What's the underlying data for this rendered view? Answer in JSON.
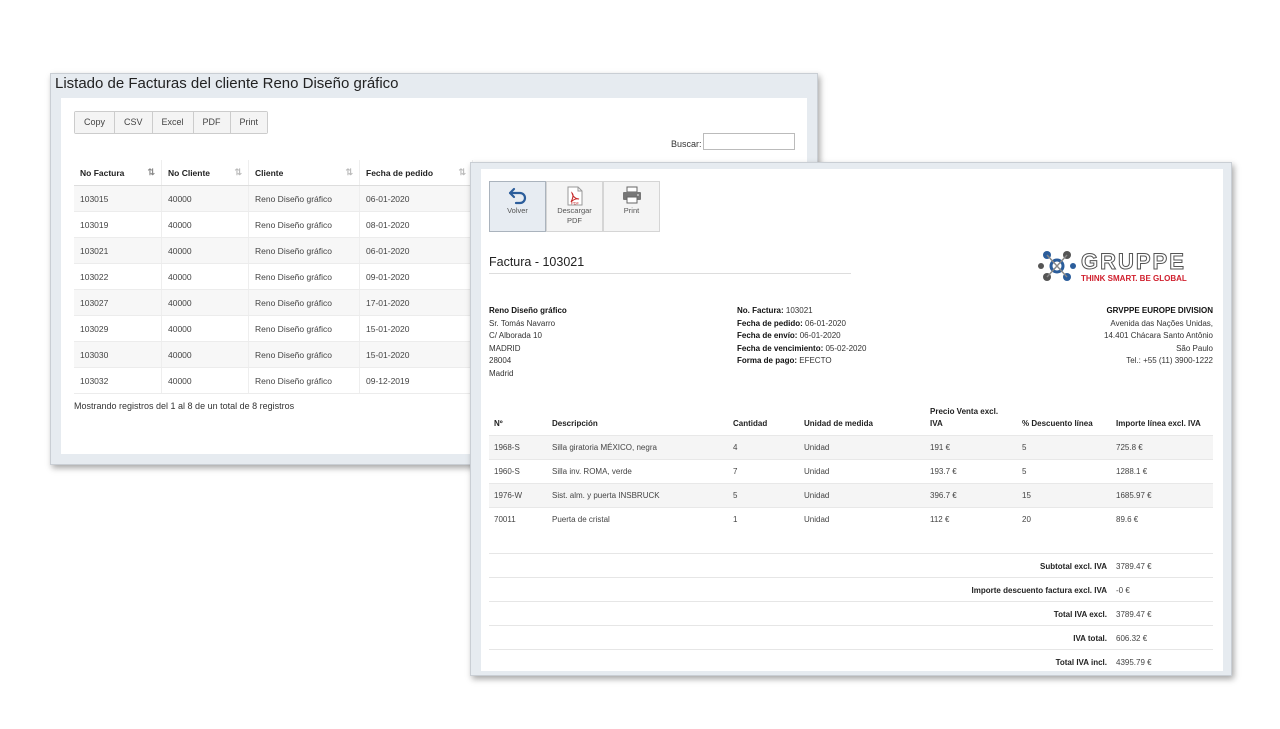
{
  "list": {
    "title": "Listado de Facturas del cliente Reno Diseño gráfico",
    "buttons": [
      "Copy",
      "CSV",
      "Excel",
      "PDF",
      "Print"
    ],
    "search_label": "Buscar:",
    "columns": [
      "No Factura",
      "No Cliente",
      "Cliente",
      "Fecha de pedido"
    ],
    "rows": [
      [
        "103015",
        "40000",
        "Reno Diseño gráfico",
        "06-01-2020"
      ],
      [
        "103019",
        "40000",
        "Reno Diseño gráfico",
        "08-01-2020"
      ],
      [
        "103021",
        "40000",
        "Reno Diseño gráfico",
        "06-01-2020"
      ],
      [
        "103022",
        "40000",
        "Reno Diseño gráfico",
        "09-01-2020"
      ],
      [
        "103027",
        "40000",
        "Reno Diseño gráfico",
        "17-01-2020"
      ],
      [
        "103029",
        "40000",
        "Reno Diseño gráfico",
        "15-01-2020"
      ],
      [
        "103030",
        "40000",
        "Reno Diseño gráfico",
        "15-01-2020"
      ],
      [
        "103032",
        "40000",
        "Reno Diseño gráfico",
        "09-12-2019"
      ]
    ],
    "info": "Mostrando registros del 1 al 8 de un total de 8 registros"
  },
  "invoice": {
    "toolbar": {
      "back": "Volver",
      "download_l1": "Descargar",
      "download_l2": "PDF",
      "print": "Print",
      "pdf_icon_text": "PDF"
    },
    "title": "Factura - 103021",
    "logo": {
      "brand": "GRUPPE",
      "tagline": "THINK SMART. BE GLOBAL"
    },
    "client": [
      "Reno Diseño gráfico",
      "Sr. Tomás Navarro",
      "C/ Alborada 10",
      "MADRID",
      "28004",
      "Madrid"
    ],
    "meta": [
      {
        "label": "No. Factura:",
        "value": "103021"
      },
      {
        "label": "Fecha de pedido:",
        "value": "06-01-2020"
      },
      {
        "label": "Fecha de envío:",
        "value": "06-01-2020"
      },
      {
        "label": "Fecha de vencimiento:",
        "value": "05-02-2020"
      },
      {
        "label": "Forma de pago:",
        "value": "EFECTO"
      }
    ],
    "company": [
      "GRVPPE EUROPE DIVISION",
      "Avenida das Nações Unidas,",
      "14.401 Chácara Santo Antônio",
      "São Paulo",
      "Tel.: +55 (11) 3900-1222"
    ],
    "columns": [
      "Nº",
      "Descripción",
      "Cantidad",
      "Unidad de medida",
      "Precio Venta excl. IVA",
      "% Descuento línea",
      "Importe línea excl. IVA"
    ],
    "lines": [
      [
        "1968-S",
        "Silla giratoria MÉXICO, negra",
        "4",
        "Unidad",
        "191 €",
        "5",
        "725.8 €"
      ],
      [
        "1960-S",
        "Silla inv. ROMA, verde",
        "7",
        "Unidad",
        "193.7 €",
        "5",
        "1288.1 €"
      ],
      [
        "1976-W",
        "Sist. alm. y puerta INSBRUCK",
        "5",
        "Unidad",
        "396.7 €",
        "15",
        "1685.97 €"
      ],
      [
        "70011",
        "Puerta de cristal",
        "1",
        "Unidad",
        "112 €",
        "20",
        "89.6 €"
      ]
    ],
    "totals": [
      {
        "label": "Subtotal excl. IVA",
        "value": "3789.47 €"
      },
      {
        "label": "Importe descuento factura excl. IVA",
        "value": "-0 €"
      },
      {
        "label": "Total IVA excl.",
        "value": "3789.47 €"
      },
      {
        "label": "IVA total.",
        "value": "606.32 €"
      },
      {
        "label": "Total IVA incl.",
        "value": "4395.79 €"
      }
    ]
  },
  "colors": {
    "accent_blue": "#2b5d9b",
    "brand_red": "#d0202e"
  }
}
